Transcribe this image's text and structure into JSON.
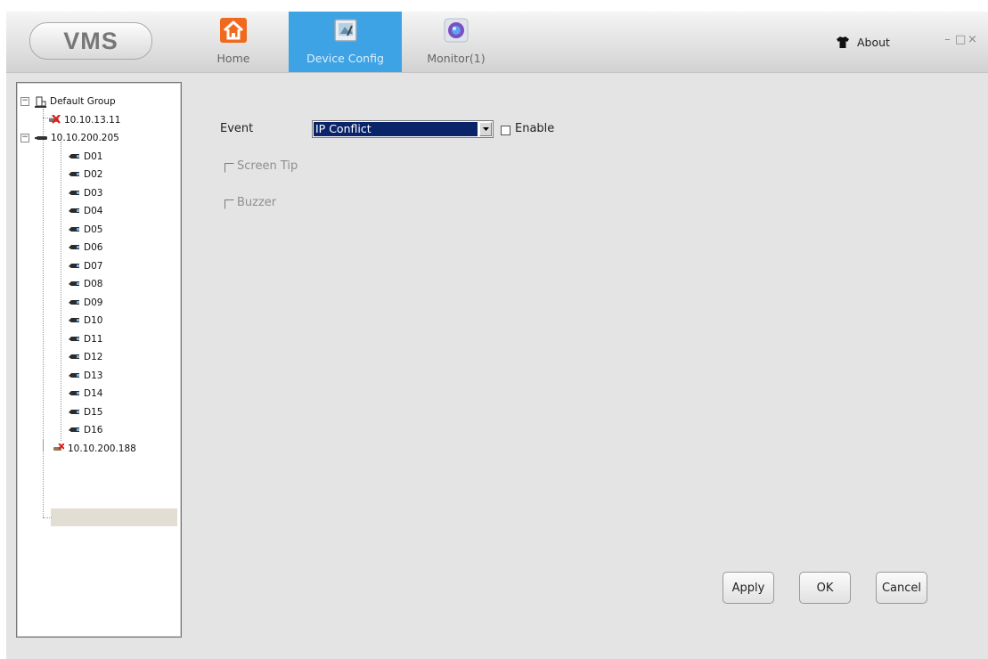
{
  "app": {
    "logo": "VMS"
  },
  "nav": {
    "tabs": [
      {
        "label": "Home",
        "icon": "home-icon",
        "active": false
      },
      {
        "label": "Device Config",
        "icon": "device-config-icon",
        "active": true
      },
      {
        "label": "Monitor(1)",
        "icon": "monitor-icon",
        "active": false
      }
    ],
    "about": "About",
    "window_controls": {
      "minimize": "–",
      "maximize": "□",
      "close": "×"
    }
  },
  "tree": {
    "group": "Default Group",
    "devices": [
      {
        "label": "10.10.13.11",
        "status": "offline"
      },
      {
        "label": "10.10.200.205",
        "status": "online",
        "expanded": true,
        "channels": [
          "D01",
          "D02",
          "D03",
          "D04",
          "D05",
          "D06",
          "D07",
          "D08",
          "D09",
          "D10",
          "D11",
          "D12",
          "D13",
          "D14",
          "D15",
          "D16"
        ]
      },
      {
        "label": "10.10.200.188",
        "status": "selected"
      }
    ]
  },
  "form": {
    "event_label": "Event",
    "event_value": "IP Conflict",
    "enable_label": "Enable",
    "screen_tip_label": "Screen Tip",
    "buzzer_label": "Buzzer"
  },
  "buttons": {
    "apply": "Apply",
    "ok": "OK",
    "cancel": "Cancel"
  },
  "colors": {
    "active_tab": "#3ea3e4",
    "selection": "#0a246a",
    "background": "#e4e4e4"
  }
}
